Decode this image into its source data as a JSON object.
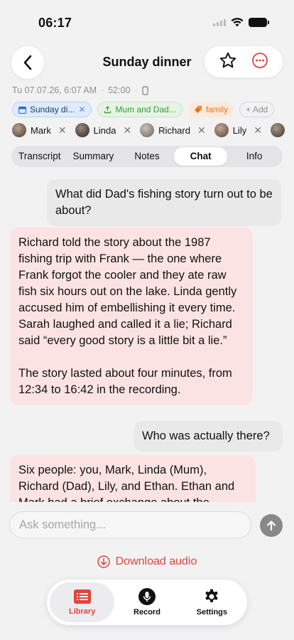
{
  "status": {
    "time": "06:17"
  },
  "header": {
    "title": "Sunday dinner"
  },
  "meta": {
    "date": "Tu 07.07.26, 6:07 AM",
    "duration": "52:00"
  },
  "tags": [
    {
      "label": "Sunday di...",
      "kind": "calendar"
    },
    {
      "label": "Mum and Dad...",
      "kind": "green"
    },
    {
      "label": "family",
      "kind": "family"
    },
    {
      "label": "+ Add",
      "kind": "add"
    }
  ],
  "people": [
    "Mark",
    "Linda",
    "Richard",
    "Lily"
  ],
  "tabs": [
    "Transcript",
    "Summary",
    "Notes",
    "Chat",
    "Info"
  ],
  "active_tab": "Chat",
  "chat": {
    "q1": "What did Dad's fishing story turn out to be about?",
    "a1": "Richard told the story about the 1987 fishing trip with Frank — the one where Frank forgot the cooler and they ate raw fish six hours out on the lake. Linda gently accused him of embellishing it every time. Sarah laughed and called it a lie; Richard said “every good story is a little bit a lie.”\n\nThe story lasted about four minutes, from 12:34 to 16:42 in the recording.",
    "q2": "Who was actually there?",
    "a2": "Six people: you, Mark, Linda (Mum), Richard (Dad), Lily, and Ethan. Ethan and Mark had a brief exchange about the"
  },
  "ask": {
    "placeholder": "Ask something..."
  },
  "download_label": "Download audio",
  "tabbar": {
    "library": "Library",
    "record": "Record",
    "settings": "Settings"
  },
  "colors": {
    "accent": "#e0443c",
    "ai_bubble": "#fce3e3",
    "user_bubble": "#e9e9ea"
  }
}
